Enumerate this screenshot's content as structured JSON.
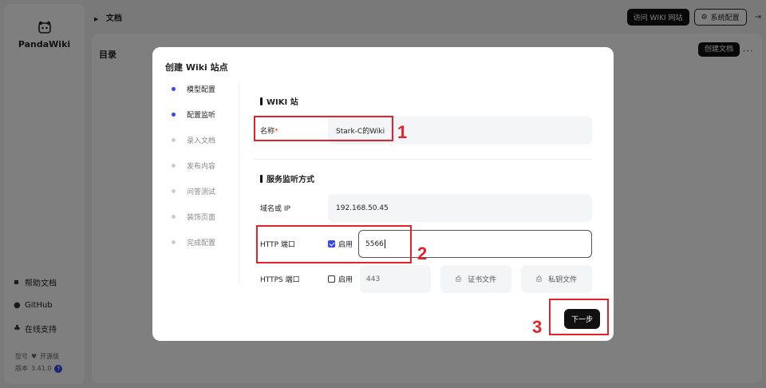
{
  "sidebar": {
    "brand": "PandaWiki",
    "links": [
      {
        "icon": "doc-icon",
        "label": "帮助文档"
      },
      {
        "icon": "github-icon",
        "label": "GitHub"
      },
      {
        "icon": "support-icon",
        "label": "在线支持"
      }
    ],
    "model_label": "型号",
    "edition": "开源版",
    "version_label": "版本",
    "version": "3.41.0"
  },
  "topbar": {
    "breadcrumb": "文档",
    "visit_wiki": "访问 WIKI 网站",
    "system_config": "系统配置"
  },
  "main": {
    "title": "目录",
    "create_doc": "创建文档",
    "more": "···"
  },
  "modal": {
    "title": "创建 Wiki 站点",
    "steps": [
      {
        "label": "模型配置",
        "state": "done"
      },
      {
        "label": "配置监听",
        "state": "active"
      },
      {
        "label": "录入文档",
        "state": "pending"
      },
      {
        "label": "发布内容",
        "state": "pending"
      },
      {
        "label": "问答测试",
        "state": "pending"
      },
      {
        "label": "装饰页面",
        "state": "pending"
      },
      {
        "label": "完成配置",
        "state": "pending"
      }
    ],
    "section1": "WIKI 站",
    "name_label": "名称",
    "name_required": "*",
    "name_value": "Stark-C的Wiki",
    "section2": "服务监听方式",
    "domain_label": "域名或 IP",
    "domain_value": "192.168.50.45",
    "http_label": "HTTP 端口",
    "http_enabled": true,
    "enable_label": "启用",
    "http_port": "5566",
    "https_label": "HTTPS 端口",
    "https_enabled": false,
    "https_port": "443",
    "cert_file": "证书文件",
    "key_file": "私钥文件",
    "next": "下一步"
  },
  "annotations": [
    "1",
    "2",
    "3"
  ],
  "colors": {
    "accent": "#3248e8",
    "annotation": "#e3232b",
    "dark_button": "#111111"
  }
}
